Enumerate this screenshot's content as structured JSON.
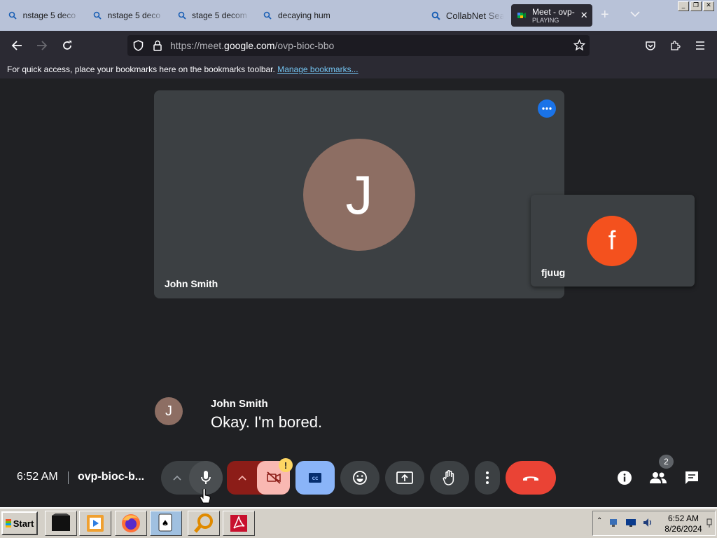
{
  "browser": {
    "tabs": [
      {
        "title": "nstage 5 deco",
        "icon": "search-icon"
      },
      {
        "title": "nstage 5 deco",
        "icon": "search-icon"
      },
      {
        "title": "stage 5 decom",
        "icon": "search-icon"
      },
      {
        "title": "decaying hum",
        "icon": "search-icon"
      },
      {
        "title": "CollabNet Sea",
        "icon": "search-icon"
      },
      {
        "title": "Meet - ovp-",
        "subtitle": "PLAYING",
        "icon": "google-meet-icon",
        "active": true
      }
    ],
    "url": {
      "prefix": "https://meet.",
      "domain": "google.com",
      "path": "/ovp-bioc-bbo"
    },
    "bookmarks_bar": {
      "message": "For quick access, place your bookmarks here on the bookmarks toolbar.",
      "link": "Manage bookmarks..."
    }
  },
  "meet": {
    "main_participant": {
      "initial": "J",
      "name": "John Smith",
      "avatar_color": "#8d6e63"
    },
    "side_participant": {
      "initial": "f",
      "name": "fjuug",
      "avatar_color": "#f4511e"
    },
    "caption": {
      "initial": "J",
      "speaker": "John Smith",
      "text": "Okay. I'm bored."
    },
    "footer": {
      "time": "6:52 AM",
      "meeting_code": "ovp-bioc-b...",
      "people_count": "2"
    },
    "warning_badge": "!",
    "end_call_color": "#ea4335"
  },
  "taskbar": {
    "start_label": "Start",
    "clock_time": "6:52 AM",
    "clock_date": "8/26/2024"
  }
}
